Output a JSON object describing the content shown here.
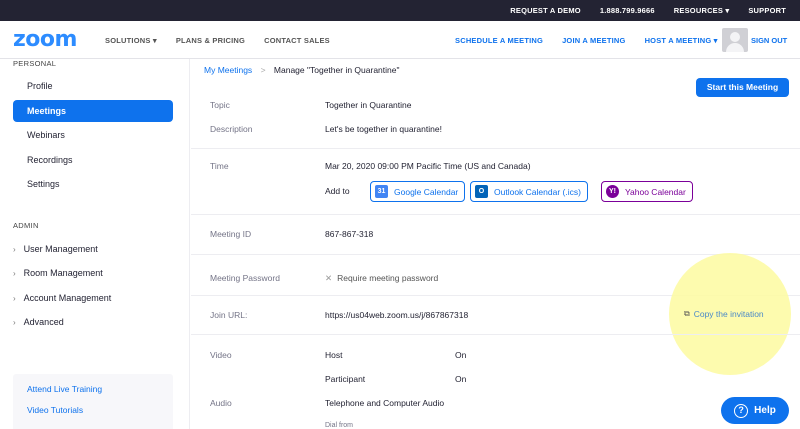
{
  "topbar": {
    "request_demo": "REQUEST A DEMO",
    "phone": "1.888.799.9666",
    "resources": "RESOURCES ▾",
    "support": "SUPPORT"
  },
  "nav": {
    "logo": "zoom",
    "solutions": "SOLUTIONS ▾",
    "plans": "PLANS & PRICING",
    "contact": "CONTACT SALES",
    "schedule": "SCHEDULE A MEETING",
    "join": "JOIN A MEETING",
    "host": "HOST A MEETING ▾",
    "signout": "SIGN OUT"
  },
  "sidebar": {
    "personal_heading": "PERSONAL",
    "items": [
      {
        "label": "Profile"
      },
      {
        "label": "Meetings"
      },
      {
        "label": "Webinars"
      },
      {
        "label": "Recordings"
      },
      {
        "label": "Settings"
      }
    ],
    "admin_heading": "ADMIN",
    "admin_items": [
      {
        "label": "User Management"
      },
      {
        "label": "Room Management"
      },
      {
        "label": "Account Management"
      },
      {
        "label": "Advanced"
      }
    ],
    "links": [
      {
        "label": "Attend Live Training"
      },
      {
        "label": "Video Tutorials"
      }
    ]
  },
  "content": {
    "breadcrumb_link": "My Meetings",
    "breadcrumb_sep": ">",
    "breadcrumb_current": "Manage \"Together in Quarantine\"",
    "start_button": "Start this Meeting",
    "topic_label": "Topic",
    "topic_value": "Together in Quarantine",
    "description_label": "Description",
    "description_value": "Let's be together in quarantine!",
    "time_label": "Time",
    "time_value": "Mar 20, 2020 09:00 PM Pacific Time (US and Canada)",
    "add_to": "Add to",
    "google_calendar": "Google Calendar",
    "outlook_calendar": "Outlook Calendar (.ics)",
    "yahoo_calendar": "Yahoo Calendar",
    "meeting_id_label": "Meeting ID",
    "meeting_id_value": "867-867-318",
    "password_label": "Meeting Password",
    "password_value": "Require meeting password",
    "join_url_label": "Join URL:",
    "join_url_value": "https://us04web.zoom.us/j/867867318",
    "copy_invitation": "Copy the invitation",
    "video_label": "Video",
    "host_label": "Host",
    "host_value": "On",
    "participant_label": "Participant",
    "participant_value": "On",
    "audio_label": "Audio",
    "audio_value": "Telephone and Computer Audio",
    "dial_from": "Dial from"
  },
  "help": {
    "label": "Help"
  },
  "colors": {
    "accent": "#0e72ed",
    "yahoo": "#7b0099",
    "highlight": "#fdfaa0"
  }
}
